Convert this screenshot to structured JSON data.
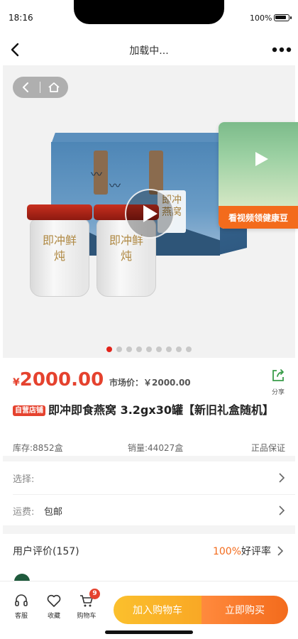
{
  "status_bar": {
    "time": "18:16",
    "battery": "100%"
  },
  "nav": {
    "title": "加载中..."
  },
  "gallery": {
    "jar_text": "即冲鲜炖",
    "box_text": "即冲燕窝",
    "video_card_text": "看视频领健康豆",
    "slide_count": 9,
    "active_slide": 1
  },
  "price": {
    "symbol": "¥",
    "value": "2000.00",
    "market_price": "市场价：￥2000.00"
  },
  "share": {
    "label": "分享"
  },
  "product": {
    "badge": "自营店铺",
    "title": "即冲即食燕窝 3.2gx30罐【新旧礼盒随机】"
  },
  "stats": {
    "stock": "库存:8852盒",
    "sales": "销量:44027盒",
    "guarantee": "正品保证"
  },
  "options": {
    "select_label": "选择:",
    "shipping_label": "运费:",
    "shipping_value": "包邮"
  },
  "reviews": {
    "title": "用户评价(157)",
    "rate_value": "100%",
    "rate_label": "好评率"
  },
  "bottom_bar": {
    "service_label": "客服",
    "favorite_label": "收藏",
    "cart_label": "购物车",
    "cart_count": "9",
    "add_to_cart": "加入购物车",
    "buy_now": "立即购买"
  },
  "colors": {
    "price_red": "#e5422e",
    "accent_orange": "#f36b1c",
    "accent_yellow": "#f9a825"
  }
}
